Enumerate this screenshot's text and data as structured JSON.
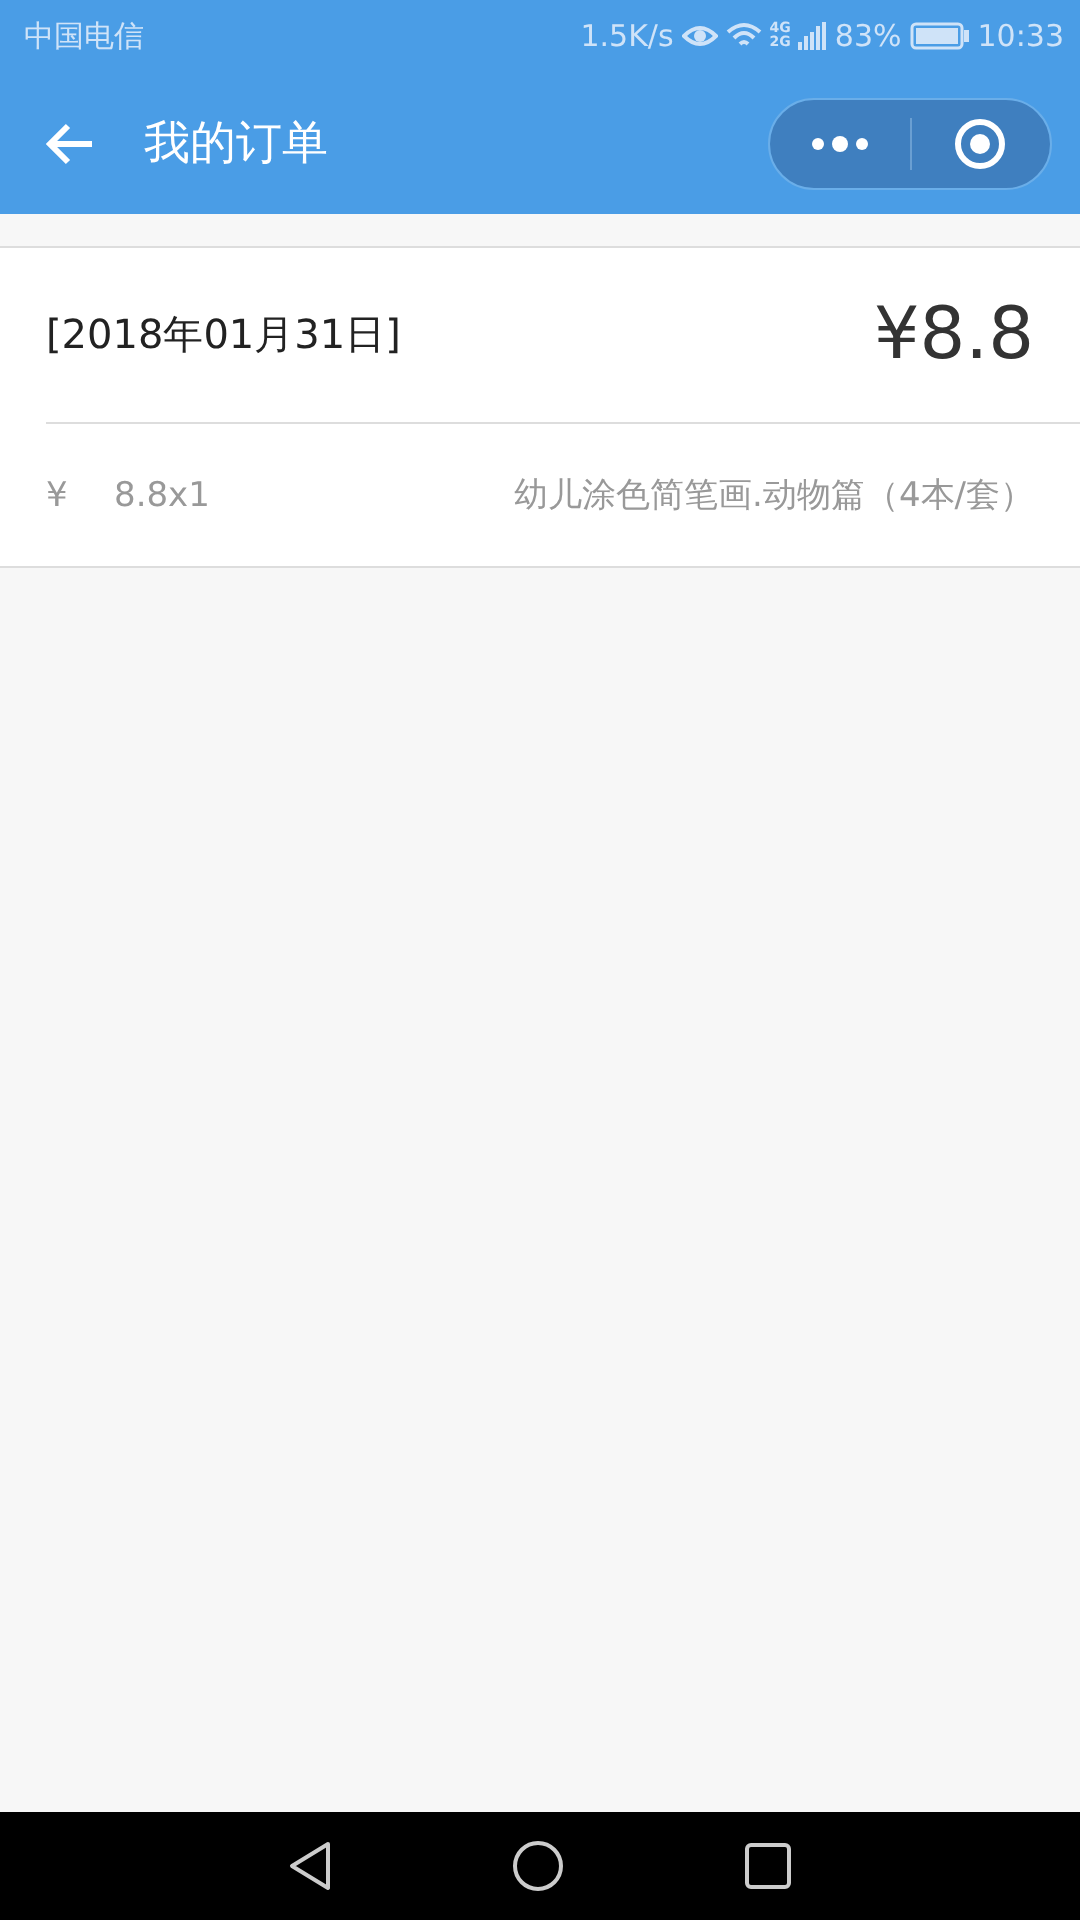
{
  "status_bar": {
    "carrier": "中国电信",
    "speed": "1.5K/s",
    "network_top": "4G",
    "network_bottom": "2G",
    "battery": "83%",
    "time": "10:33"
  },
  "header": {
    "title": "我的订单"
  },
  "orders": [
    {
      "date": "[2018年01月31日]",
      "total": "¥8.8",
      "items": [
        {
          "currency": "¥",
          "price": "8.8x1",
          "name": "幼儿涂色简笔画.动物篇（4本/套）"
        }
      ]
    }
  ]
}
